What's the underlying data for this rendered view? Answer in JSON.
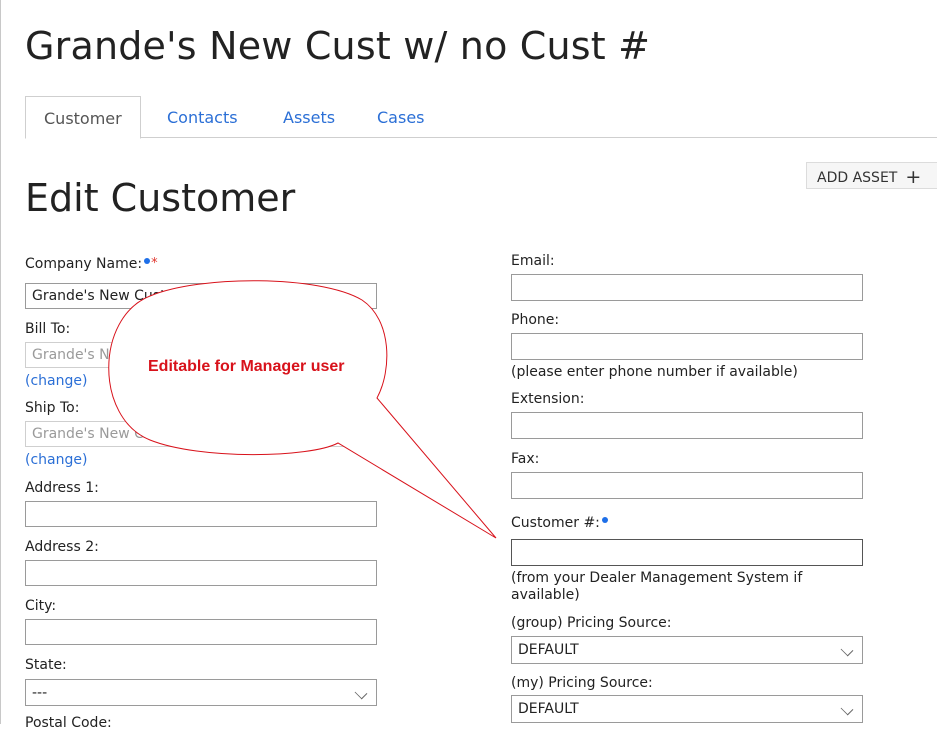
{
  "page_title": "Grande's New Cust w/ no Cust #",
  "tabs": [
    {
      "label": "Customer",
      "active": true
    },
    {
      "label": "Contacts",
      "active": false
    },
    {
      "label": "Assets",
      "active": false
    },
    {
      "label": "Cases",
      "active": false
    }
  ],
  "add_asset": {
    "label": "ADD ASSET",
    "icon": "plus-icon"
  },
  "section_title": "Edit Customer",
  "left": {
    "company_name": {
      "label": "Company Name:",
      "required_marker": "*",
      "value": "Grande's New Cust w/ no Cust #"
    },
    "bill_to": {
      "label": "Bill To:",
      "value": "Grande's New Cust w/ no Cust #",
      "change_link": "(change)"
    },
    "ship_to": {
      "label": "Ship To:",
      "value": "Grande's New Cust w/ no Cust #",
      "change_link": "(change)"
    },
    "address1": {
      "label": "Address 1:",
      "value": ""
    },
    "address2": {
      "label": "Address 2:",
      "value": ""
    },
    "city": {
      "label": "City:",
      "value": ""
    },
    "state": {
      "label": "State:",
      "value": "---"
    },
    "postal_code": {
      "label": "Postal Code:"
    }
  },
  "right": {
    "email": {
      "label": "Email:",
      "value": ""
    },
    "phone": {
      "label": "Phone:",
      "value": "",
      "hint": "(please enter phone number if available)"
    },
    "extension": {
      "label": "Extension:",
      "value": ""
    },
    "fax": {
      "label": "Fax:",
      "value": ""
    },
    "customer_number": {
      "label": "Customer #:",
      "value": "",
      "hint_line1": "(from your Dealer Management System if",
      "hint_line2": "available)"
    },
    "group_pricing": {
      "label": "(group) Pricing Source:",
      "value": "DEFAULT"
    },
    "my_pricing": {
      "label": "(my) Pricing Source:",
      "value": "DEFAULT"
    }
  },
  "callout": {
    "text": "Editable for Manager user",
    "color": "#d8121b"
  },
  "colors": {
    "link": "#2b6fd6",
    "required_dot": "#1e6fe8",
    "required_star": "#e0342c"
  }
}
